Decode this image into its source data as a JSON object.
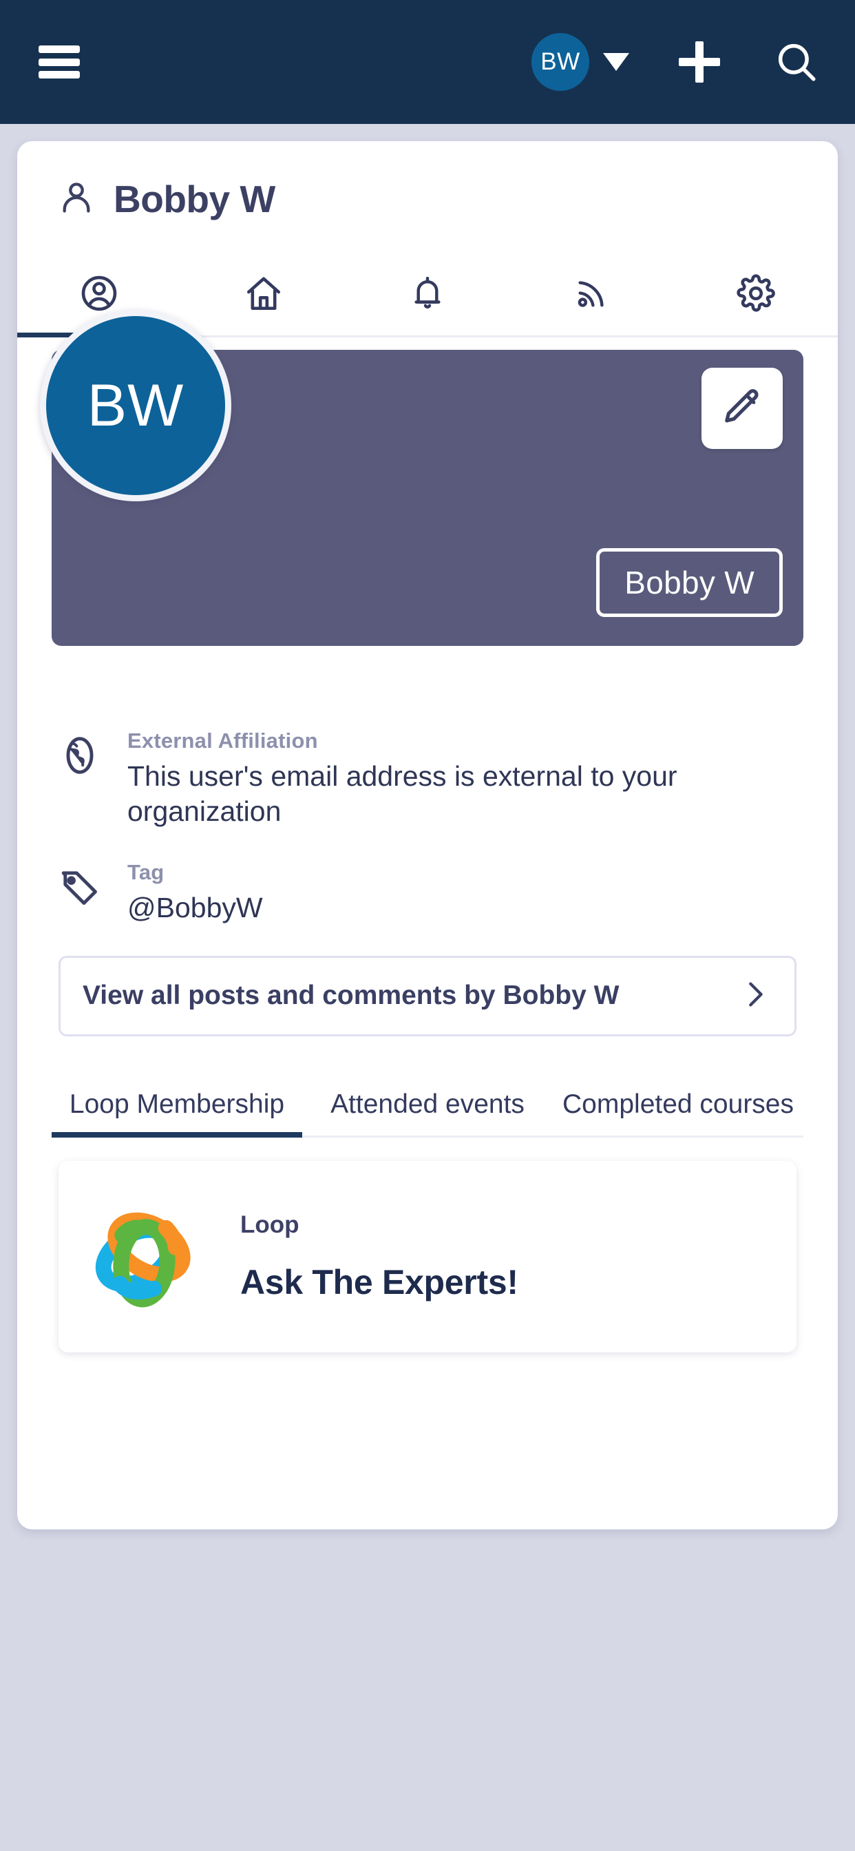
{
  "topbar": {
    "menu_icon": "hamburger-menu-icon",
    "avatar_initials": "BW",
    "caret_icon": "chevron-down-icon",
    "add_icon": "plus-icon",
    "search_icon": "search-icon",
    "background_color": "#16314f",
    "avatar_color": "#0d6299"
  },
  "profile": {
    "title": "Bobby W",
    "title_icon": "user-icon",
    "icon_tabs": [
      {
        "name": "profile",
        "icon": "user-circle-icon",
        "active": true
      },
      {
        "name": "home",
        "icon": "home-icon",
        "active": false
      },
      {
        "name": "notifications",
        "icon": "bell-icon",
        "active": false
      },
      {
        "name": "activity",
        "icon": "rss-icon",
        "active": false
      },
      {
        "name": "settings",
        "icon": "gear-icon",
        "active": false
      }
    ],
    "banner": {
      "background_color": "#5a5b7c",
      "edit_icon": "pencil-icon",
      "name_badge": "Bobby W",
      "avatar_initials": "BW",
      "avatar_color": "#0d6299"
    },
    "info": [
      {
        "icon": "globe-icon",
        "label": "External Affiliation",
        "value": "This user's email address is external to your organization"
      },
      {
        "icon": "tag-icon",
        "label": "Tag",
        "value": "@BobbyW"
      }
    ],
    "view_all": {
      "label": "View all posts and comments by Bobby W",
      "icon": "chevron-right-icon"
    },
    "tabs": [
      {
        "label": "Loop Membership",
        "active": true
      },
      {
        "label": "Attended events",
        "active": false
      },
      {
        "label": "Completed courses",
        "active": false
      }
    ],
    "loop_card": {
      "logo_icon": "loop-rings-logo",
      "label": "Loop",
      "title": "Ask The Experts!",
      "colors": {
        "blue": "#19b0e6",
        "orange": "#f79025",
        "green": "#5cb541"
      }
    }
  }
}
